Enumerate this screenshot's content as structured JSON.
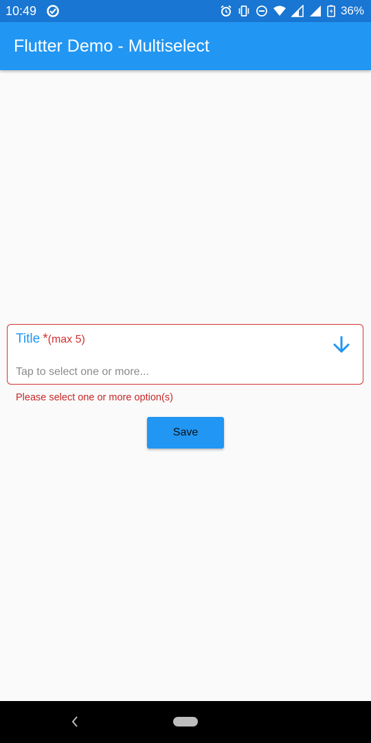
{
  "status_bar": {
    "time": "10:49",
    "battery": "36%",
    "icons": [
      "data-saver-icon",
      "alarm-icon",
      "vibrate-icon",
      "do-not-disturb-icon",
      "wifi-icon",
      "signal-icon",
      "signal-icon",
      "battery-charging-icon"
    ]
  },
  "app_bar": {
    "title": "Flutter Demo - Multiselect",
    "color": "#2196f3"
  },
  "field": {
    "label": "Title",
    "required_mark": "*",
    "hint": "(max 5)",
    "placeholder": "Tap to select one or more...",
    "error": "Please select one or more option(s)",
    "icon": "arrow-down-icon",
    "error_color": "#d32f2f"
  },
  "actions": {
    "save_label": "Save"
  },
  "nav_bar": {
    "icons": [
      "back-icon",
      "home-pill-icon"
    ]
  }
}
